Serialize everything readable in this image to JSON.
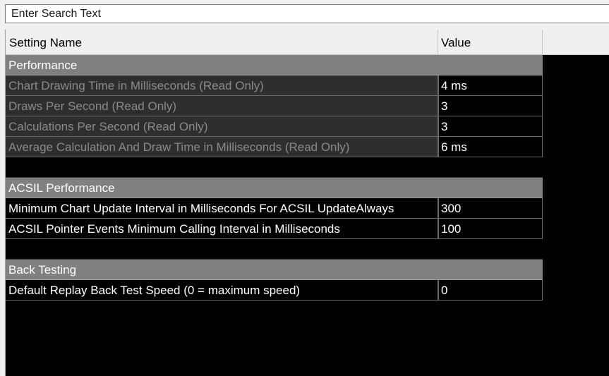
{
  "search": {
    "value": "Enter Search Text"
  },
  "columns": {
    "name": "Setting Name",
    "value": "Value"
  },
  "groups": [
    {
      "title": "Performance",
      "rows": [
        {
          "name": "Chart Drawing Time in Milliseconds (Read Only)",
          "value": "4 ms",
          "readonly": true
        },
        {
          "name": "Draws Per Second (Read Only)",
          "value": "3",
          "readonly": true
        },
        {
          "name": "Calculations Per Second (Read Only)",
          "value": "3",
          "readonly": true
        },
        {
          "name": "Average Calculation And Draw Time in Milliseconds (Read Only)",
          "value": "6 ms",
          "readonly": true
        }
      ]
    },
    {
      "title": "ACSIL Performance",
      "rows": [
        {
          "name": "Minimum Chart Update Interval in Milliseconds For ACSIL UpdateAlways",
          "value": "300",
          "readonly": false
        },
        {
          "name": "ACSIL Pointer Events Minimum Calling Interval in Milliseconds",
          "value": "100",
          "readonly": false
        }
      ]
    },
    {
      "title": "Back Testing",
      "rows": [
        {
          "name": "Default Replay Back Test Speed (0 = maximum speed)",
          "value": "0",
          "readonly": false
        }
      ]
    }
  ],
  "colors": {
    "group_header_bg": "#808080",
    "readonly_text": "#8a8a8a",
    "grid_bg": "#000000"
  }
}
